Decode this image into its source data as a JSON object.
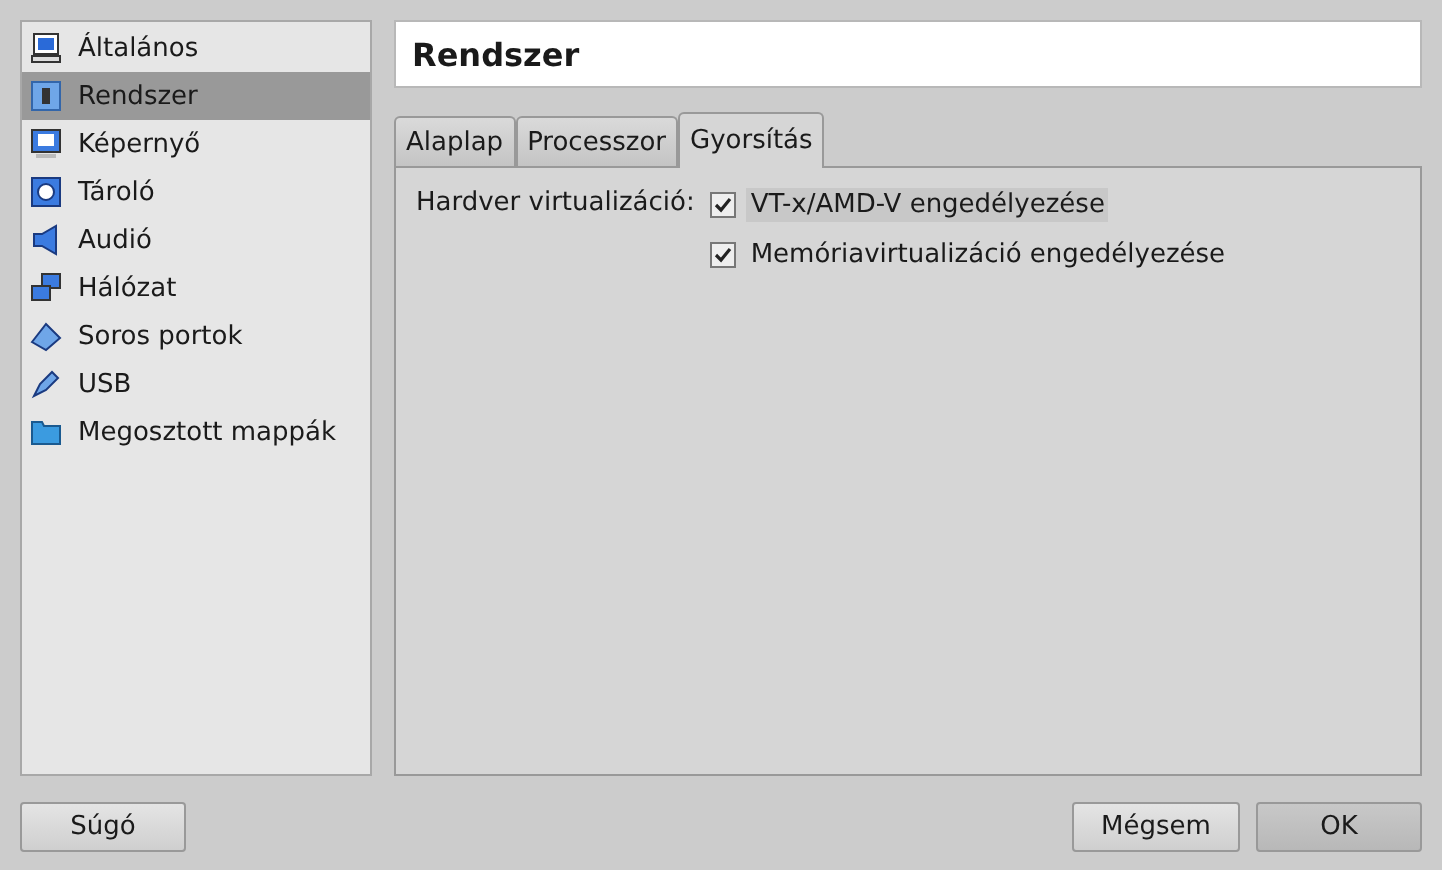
{
  "sidebar": {
    "items": [
      {
        "label": "Általános",
        "selected": false
      },
      {
        "label": "Rendszer",
        "selected": true
      },
      {
        "label": "Képernyő",
        "selected": false
      },
      {
        "label": "Tároló",
        "selected": false
      },
      {
        "label": "Audió",
        "selected": false
      },
      {
        "label": "Hálózat",
        "selected": false
      },
      {
        "label": "Soros portok",
        "selected": false
      },
      {
        "label": "USB",
        "selected": false
      },
      {
        "label": "Megosztott mappák",
        "selected": false
      }
    ]
  },
  "page_title": "Rendszer",
  "tabs": [
    {
      "label": "Alaplap",
      "selected": false
    },
    {
      "label": "Processzor",
      "selected": false
    },
    {
      "label": "Gyorsítás",
      "selected": true
    }
  ],
  "acceleration": {
    "label": "Hardver virtualizáció:",
    "options": [
      {
        "label": "VT-x/AMD-V engedélyezése",
        "checked": true,
        "focused": true
      },
      {
        "label": "Memóriavirtualizáció engedélyezése",
        "checked": true,
        "focused": false
      }
    ]
  },
  "buttons": {
    "help": "Súgó",
    "cancel": "Mégsem",
    "ok": "OK"
  }
}
